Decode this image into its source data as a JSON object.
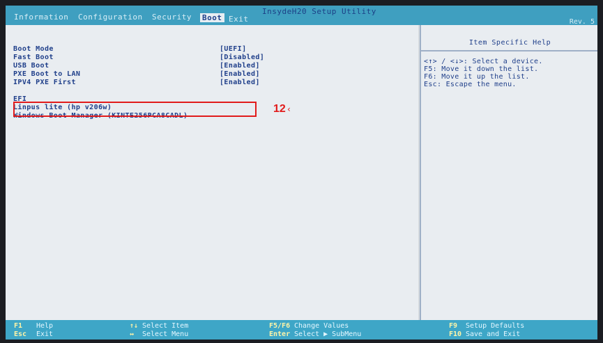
{
  "topbar": {
    "title": "InsydeH20 Setup Utility",
    "revision": "Rev. 5",
    "tabs": [
      {
        "label": "Information"
      },
      {
        "label": "Configuration"
      },
      {
        "label": "Security"
      },
      {
        "label": "Boot"
      },
      {
        "label": "Exit"
      }
    ]
  },
  "boot": {
    "rows": [
      {
        "label": "Boot Mode",
        "value": "[UEFI]"
      },
      {
        "label": "Fast Boot",
        "value": "[Disabled]"
      },
      {
        "label": "USB Boot",
        "value": "[Enabled]"
      },
      {
        "label": "PXE Boot to LAN",
        "value": "[Enabled]"
      },
      {
        "label": "IPV4 PXE First",
        "value": "[Enabled]"
      }
    ],
    "section_label": "EFI",
    "devices": [
      {
        "label": "Linpus lite (hp      v206w)"
      },
      {
        "label": "Windows Boot Manager (KINTE256PCA8CADL)"
      }
    ]
  },
  "help": {
    "title": "Item Specific Help",
    "lines": [
      "<↑> / <↓>: Select a device.",
      "F5: Move it down the list.",
      "F6: Move it up the list.",
      "Esc: Escape the menu."
    ]
  },
  "annotation": {
    "callout": "12"
  },
  "bottombar": {
    "items": [
      {
        "key": "F1",
        "text": "Help"
      },
      {
        "key": "Esc",
        "text": "Exit"
      },
      {
        "key": "↑↓",
        "text": "Select Item"
      },
      {
        "key": "↔",
        "text": "Select Menu"
      },
      {
        "key": "F5/F6",
        "text": "Change Values"
      },
      {
        "key": "Enter",
        "text": "Select ▶ SubMenu"
      },
      {
        "key": "F9",
        "text": "Setup Defaults"
      },
      {
        "key": "F10",
        "text": "Save and Exit"
      }
    ]
  },
  "colors": {
    "bar": "#3f9fc0",
    "panel": "#e9edf1",
    "text": "#1f3f8a",
    "highlight": "#e11b1b"
  }
}
